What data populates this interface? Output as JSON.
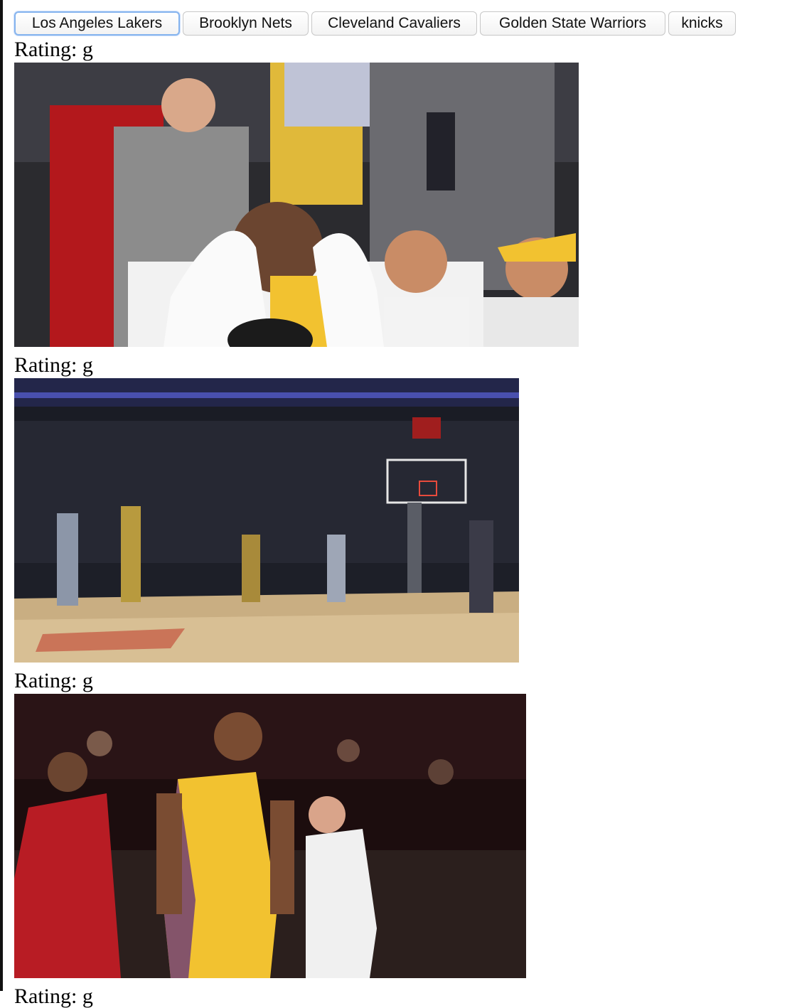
{
  "buttons": [
    {
      "label": "Los Angeles Lakers",
      "focused": true
    },
    {
      "label": "Brooklyn Nets"
    },
    {
      "label": "Cleveland Cavaliers"
    },
    {
      "label": "Golden State Warriors"
    },
    {
      "label": "knicks"
    }
  ],
  "gifs": [
    {
      "rating_label": "Rating: g"
    },
    {
      "rating_label": "Rating: g"
    },
    {
      "rating_label": "Rating: g"
    },
    {
      "rating_label": "Rating: g"
    }
  ],
  "colors": {
    "lakers_gold": "#f2c230",
    "lakers_purple": "#552583",
    "rockets_red": "#c8102e"
  }
}
